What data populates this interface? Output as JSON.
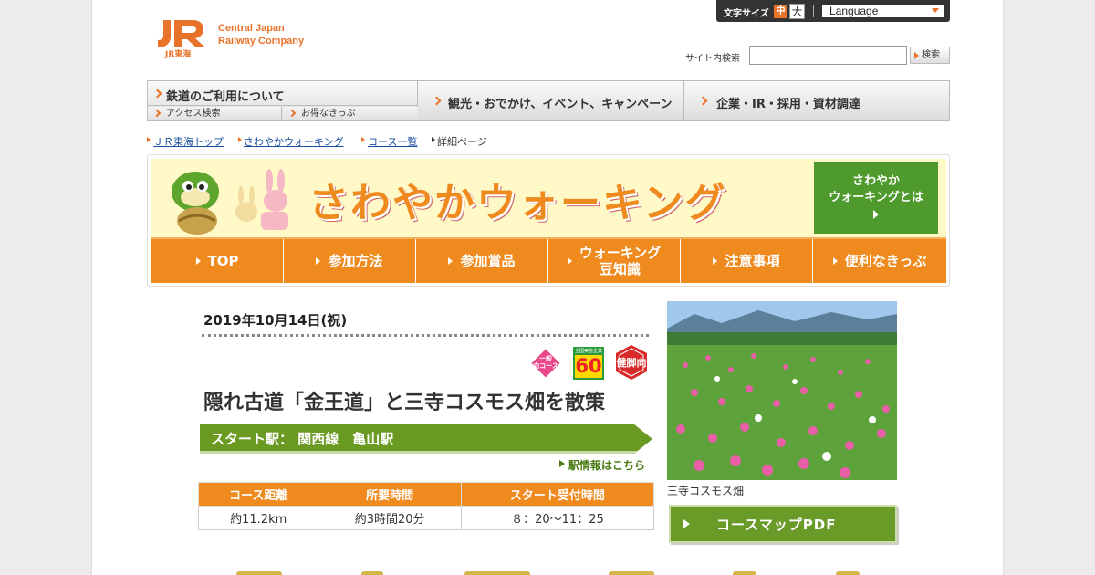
{
  "header": {
    "logo_company": "Central Japan Railway Company",
    "logo_company_line1": "Central Japan",
    "logo_company_line2": "Railway Company",
    "logo_sub": "JR東海",
    "font_size_label": "文字サイズ",
    "font_size_mid": "中",
    "font_size_big": "大",
    "language_label": "Language",
    "search_label": "サイト内検索",
    "search_value": "",
    "search_button": "検索"
  },
  "global_nav": {
    "rail": "鉄道のご利用について",
    "access": "アクセス検索",
    "tickets": "お得なきっぷ",
    "tourism": "観光・おでかけ、イベント、キャンペーン",
    "corporate": "企業・IR・採用・資材調達"
  },
  "breadcrumb": [
    {
      "label": "ＪＲ東海トップ"
    },
    {
      "label": "さわやかウォーキング"
    },
    {
      "label": "コース一覧"
    },
    {
      "label": "詳細ページ"
    }
  ],
  "banner": {
    "title": "さわやかウォーキング",
    "about_line1": "さわやか",
    "about_line2": "ウォーキングとは",
    "tabs": [
      {
        "label": "TOP"
      },
      {
        "label": "参加方法"
      },
      {
        "label": "参加賞品"
      },
      {
        "label_line1": "ウォーキング",
        "label_line2": "豆知識"
      },
      {
        "label": "注意事項"
      },
      {
        "label": "便利なきっぷ"
      }
    ]
  },
  "course": {
    "date": "2019年10月14日(祝)",
    "badges": {
      "ippan_line1": "一般",
      "ippan_line2": "向コース",
      "anniv_top": "全国実施企業",
      "anniv_number": "60",
      "kenkyaku": "健脚向"
    },
    "title": "隠れ古道「金王道」と三寺コスモス畑を散策",
    "start_station": "スタート駅： 関西線　亀山駅",
    "station_link": "駅情報はこちら",
    "table": {
      "headers": [
        "コース距離",
        "所要時間",
        "スタート受付時間"
      ],
      "values": [
        "約11.2km",
        "約3時間20分",
        "８：20～11：25"
      ]
    },
    "photo_caption": "三寺コスモス畑",
    "pdf_button": "コースマップPDF"
  },
  "colors": {
    "accent": "#ef8a1e",
    "brand": "#e8722a",
    "green": "#6b9a22",
    "banner_bg": "#fff9c8"
  }
}
